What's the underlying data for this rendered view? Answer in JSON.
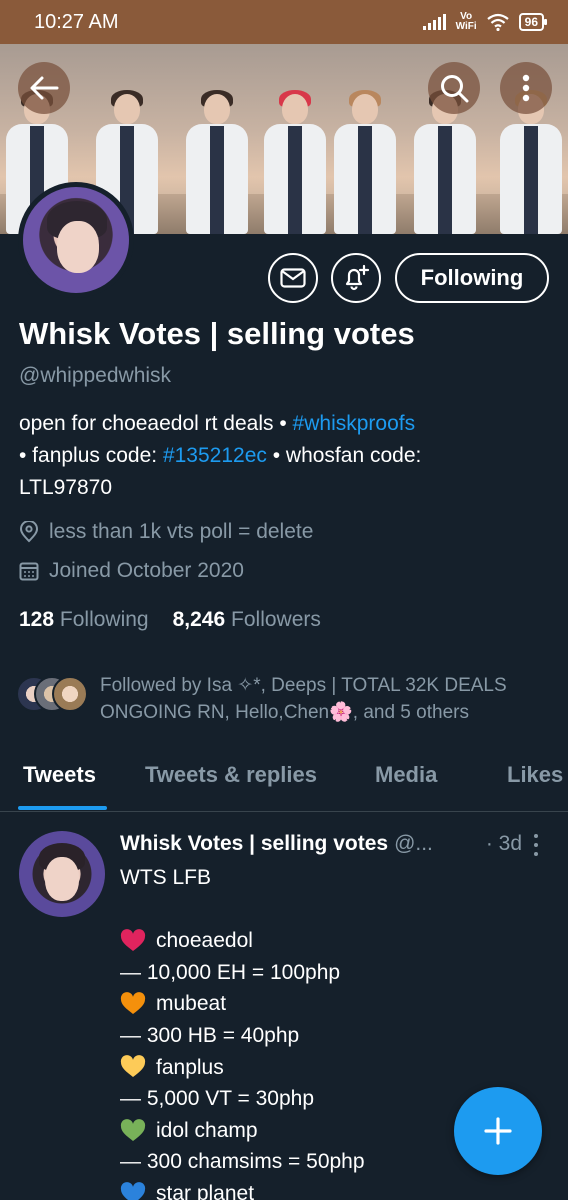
{
  "status_bar": {
    "time": "10:27 AM",
    "vowifi_line1": "Vo",
    "vowifi_line2": "WiFi",
    "battery": "96"
  },
  "profile": {
    "name": "Whisk Votes | selling votes",
    "handle": "@whippedwhisk",
    "follow_button_label": "Following",
    "bio": {
      "part1": "open for choeaedol rt deals • ",
      "hashtag1": "#whiskproofs",
      "part2": "• fanplus code: ",
      "hashtag2": "#135212ec",
      "part3": " • whosfan code:",
      "part4": "LTL97870"
    },
    "location": "less than 1k vts poll = delete",
    "joined": "Joined October 2020",
    "following_count": "128",
    "following_label": "Following",
    "followers_count": "8,246",
    "followers_label": "Followers",
    "followed_by": "Followed by Isa ✧*, Deeps | TOTAL 32K DEALS ONGOING RN, Hello,Chen🌸, and 5 others"
  },
  "tabs": [
    "Tweets",
    "Tweets & replies",
    "Media",
    "Likes"
  ],
  "tweet": {
    "name": "Whisk Votes | selling votes",
    "handle": "@...",
    "time": "· 3d",
    "lines": [
      {
        "heart": "",
        "text": "WTS LFB"
      },
      {
        "heart": "",
        "text": ""
      },
      {
        "heart": "#e0245e",
        "text": "choeaedol"
      },
      {
        "heart": "",
        "text": "— 10,000 EH = 100php"
      },
      {
        "heart": "#f4900c",
        "text": "mubeat"
      },
      {
        "heart": "",
        "text": "— 300 HB = 40php"
      },
      {
        "heart": "#fdcb58",
        "text": "fanplus"
      },
      {
        "heart": "",
        "text": "— 5,000 VT = 30php"
      },
      {
        "heart": "#78b159",
        "text": "idol champ"
      },
      {
        "heart": "",
        "text": "— 300 chamsims = 50php"
      },
      {
        "heart": "#2b82dc",
        "text": "star planet"
      }
    ]
  },
  "icons": {
    "back": "back-arrow-icon",
    "search": "search-icon",
    "more": "more-vertical-icon",
    "message": "envelope-icon",
    "notify": "bell-plus-icon",
    "location": "location-pin-icon",
    "calendar": "calendar-icon",
    "compose": "plus-icon"
  },
  "colors": {
    "background": "#15202b",
    "accent": "#1d9bf0",
    "muted": "#8899a6",
    "statusbar": "#8a5a3a"
  }
}
